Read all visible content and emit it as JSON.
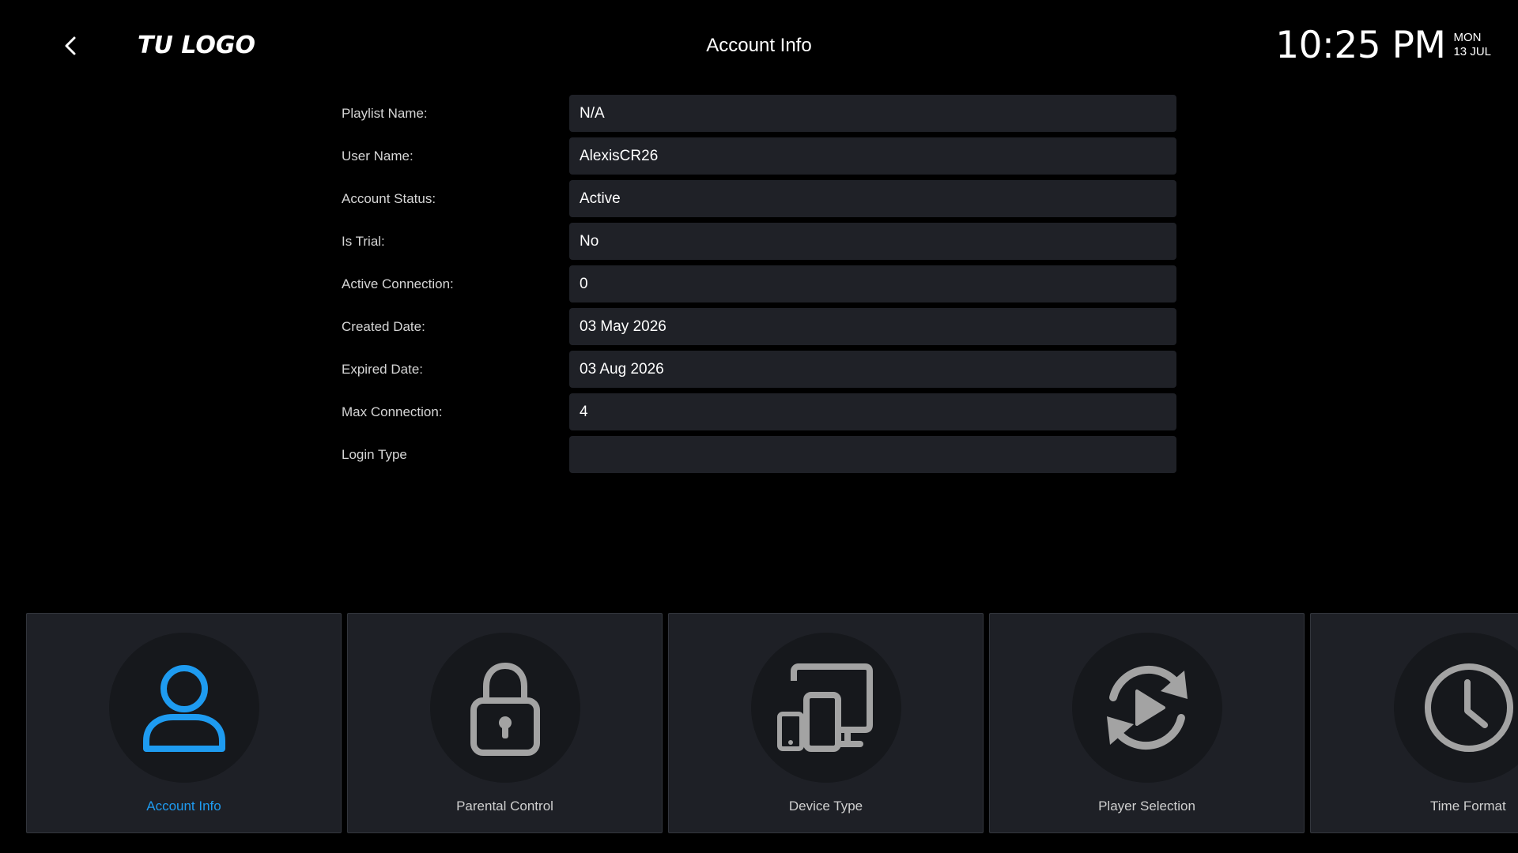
{
  "header": {
    "logo": "TU LOGO",
    "title": "Account Info",
    "clock": {
      "time": "10:25 PM",
      "weekday": "MON",
      "date": "13 JUL"
    }
  },
  "account": {
    "fields": [
      {
        "label": "Playlist Name:",
        "value": "N/A"
      },
      {
        "label": "User Name:",
        "value": "AlexisCR26"
      },
      {
        "label": "Account Status:",
        "value": "Active"
      },
      {
        "label": "Is Trial:",
        "value": "No"
      },
      {
        "label": "Active Connection:",
        "value": "0"
      },
      {
        "label": "Created Date:",
        "value": "03 May 2026"
      },
      {
        "label": "Expired Date:",
        "value": "03 Aug 2026"
      },
      {
        "label": "Max Connection:",
        "value": "4"
      },
      {
        "label": "Login Type",
        "value": ""
      }
    ]
  },
  "menu": {
    "cards": [
      {
        "label": "Account Info",
        "icon": "user-icon",
        "active": true
      },
      {
        "label": "Parental Control",
        "icon": "lock-icon",
        "active": false
      },
      {
        "label": "Device Type",
        "icon": "devices-icon",
        "active": false
      },
      {
        "label": "Player Selection",
        "icon": "play-refresh-icon",
        "active": false
      },
      {
        "label": "Time Format",
        "icon": "clock-icon",
        "active": false
      }
    ]
  },
  "colors": {
    "background": "#000000",
    "field_background": "#1f2127",
    "card_background": "#1e2026",
    "accent": "#1e9bf0",
    "icon_inactive": "#a3a3a3"
  }
}
